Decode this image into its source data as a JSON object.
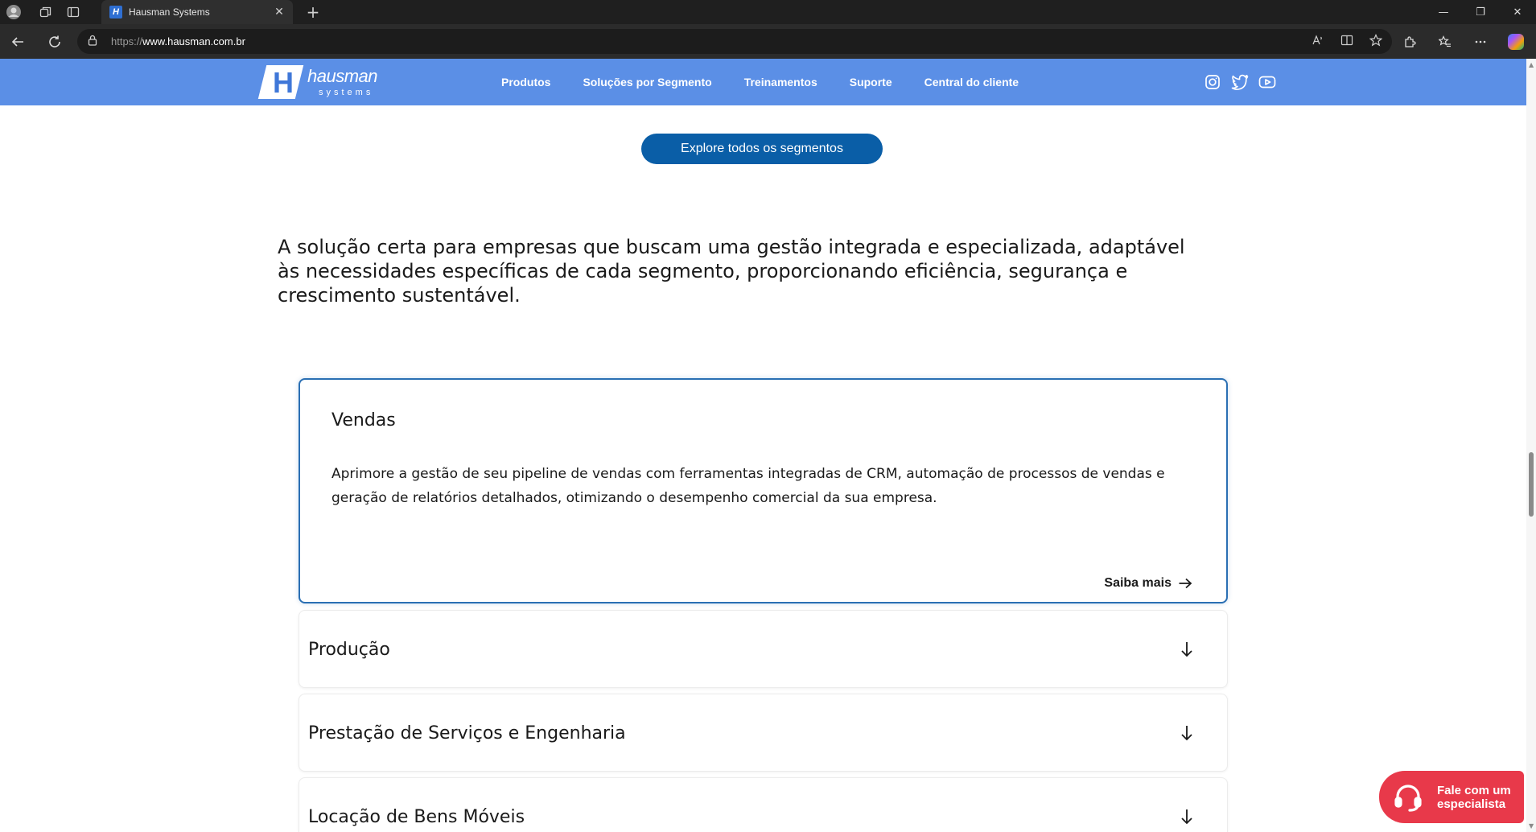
{
  "browser": {
    "tab_title": "Hausman Systems",
    "tab_favicon_letter": "H",
    "tab_close": "✕",
    "new_tab": "+",
    "url_scheme": "https://",
    "url_host": "www.hausman.com.br",
    "window_controls": [
      "—",
      "❐",
      "✕"
    ]
  },
  "site": {
    "logo": {
      "name": "hausman",
      "tagline": "systems",
      "mark_letter": "H"
    },
    "nav": [
      "Produtos",
      "Soluções por Segmento",
      "Treinamentos",
      "Suporte",
      "Central do cliente"
    ],
    "social_icons": [
      "instagram-icon",
      "twitter-icon",
      "youtube-icon"
    ]
  },
  "content": {
    "explore_label": "Explore todos os segmentos",
    "intro": "A solução certa para empresas que buscam uma gestão integrada e especializada, adaptável às necessidades específicas de cada segmento, proporcionando eficiência, segurança e crescimento sustentável.",
    "accordion": [
      {
        "title": "Vendas",
        "expanded": true,
        "description": "Aprimore a gestão de seu pipeline de vendas com ferramentas integradas de CRM, automação de processos de vendas e geração de relatórios detalhados, otimizando o desempenho comercial da sua empresa.",
        "link_label": "Saiba mais"
      },
      {
        "title": "Produção",
        "expanded": false
      },
      {
        "title": "Prestação de Serviços e Engenharia",
        "expanded": false
      },
      {
        "title": "Locação de Bens Móveis",
        "expanded": false
      }
    ]
  },
  "cta": {
    "label_line1": "Fale com um",
    "label_line2": "especialista"
  },
  "colors": {
    "header_bg": "#5b8fe6",
    "button_bg": "#0a5ea7",
    "active_border": "#2a6fb3",
    "cta_bg": "#e8394a"
  }
}
